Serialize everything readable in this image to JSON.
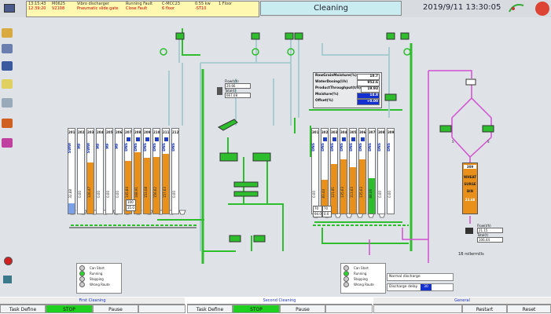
{
  "alarms": [
    {
      "time": "13:15:43",
      "id": "M0625",
      "desc": "Vibro discharger",
      "status": "Running Fault",
      "loc": "C-MCC23",
      "val": "0.55 kw",
      "floor": "1 Floor"
    },
    {
      "time": "12:39:20",
      "id": "V2108",
      "desc": "Pneumatic slide gate",
      "status": "Close Fault",
      "loc": "6 floor",
      "val": "-ST10",
      "floor": ""
    }
  ],
  "header": {
    "title": "Cleaning",
    "datetime": "2019/9/11 13:30:05"
  },
  "flow_left": {
    "title": "Flow(t/h)",
    "value1": "20.66",
    "total_label": "Total(t)",
    "value2": "667.08"
  },
  "flow_right": {
    "title": "Flow(t/h)",
    "value1": "21.15",
    "total_label": "Total(t)",
    "value2": "106.44",
    "caption": "1B rollermills"
  },
  "grain_info": [
    {
      "label": "RawGrainMoisture(%)",
      "value": "10.7",
      "blue": false
    },
    {
      "label": "WaterDosing(l/h)",
      "value": "952.6",
      "blue": false
    },
    {
      "label": "ProductThroughput(t/h)",
      "value": "19.93",
      "blue": false
    },
    {
      "label": "Moisture(%)",
      "value": "14.8",
      "blue": true
    },
    {
      "label": "Offset(%)",
      "value": "+0.00",
      "blue": true
    }
  ],
  "silos_left": [
    {
      "num": "201",
      "cls": "SWW",
      "val": "32.88",
      "fill": 0.12,
      "orange": false,
      "blue": false
    },
    {
      "num": "202",
      "cls": "MF",
      "val": "0.00",
      "fill": 0,
      "orange": false,
      "blue": false
    },
    {
      "num": "203",
      "cls": "SWW",
      "val": "126.47",
      "fill": 0.6,
      "orange": true,
      "blue": false
    },
    {
      "num": "204",
      "cls": "MF",
      "val": "0.00",
      "fill": 0,
      "orange": false,
      "blue": false
    },
    {
      "num": "205",
      "cls": "MF",
      "val": "0.00",
      "fill": 0,
      "orange": false,
      "blue": false
    },
    {
      "num": "206",
      "cls": "MF",
      "val": "0.00",
      "fill": 0,
      "orange": false,
      "blue": false
    },
    {
      "num": "207",
      "cls": "DNS",
      "val": "145.84",
      "fill": 0.62,
      "orange": true,
      "blue": true
    },
    {
      "num": "208",
      "cls": "DNS",
      "val": "168.91",
      "fill": 0.72,
      "orange": true,
      "blue": true
    },
    {
      "num": "209",
      "cls": "DNS",
      "val": "153.08",
      "fill": 0.66,
      "orange": true,
      "blue": true
    },
    {
      "num": "210",
      "cls": "DNS",
      "val": "156.62",
      "fill": 0.67,
      "orange": true,
      "blue": true
    },
    {
      "num": "211",
      "cls": "DNS",
      "val": "157.63",
      "fill": 0.7,
      "orange": true,
      "blue": true
    },
    {
      "num": "212",
      "cls": "DNS",
      "val": "0.00",
      "fill": 0,
      "orange": false,
      "blue": false
    }
  ],
  "silos_right": [
    {
      "num": "301",
      "cls": "DNS",
      "val": "0.00",
      "fill": 0,
      "orange": false,
      "blue": false,
      "green": false
    },
    {
      "num": "302",
      "cls": "DNS",
      "val": "83.44",
      "fill": 0.4,
      "orange": true,
      "blue": true,
      "green": false
    },
    {
      "num": "303",
      "cls": "DNS",
      "val": "121.81",
      "fill": 0.58,
      "orange": true,
      "blue": true,
      "green": false
    },
    {
      "num": "304",
      "cls": "DNS",
      "val": "135.63",
      "fill": 0.64,
      "orange": true,
      "blue": true,
      "green": false
    },
    {
      "num": "305",
      "cls": "DNS",
      "val": "113.63",
      "fill": 0.55,
      "orange": true,
      "blue": true,
      "green": false
    },
    {
      "num": "306",
      "cls": "DNS",
      "val": "135.63",
      "fill": 0.64,
      "orange": true,
      "blue": true,
      "green": false
    },
    {
      "num": "307",
      "cls": "DNS",
      "val": "88.06",
      "fill": 0.42,
      "orange": false,
      "blue": false,
      "green": true
    },
    {
      "num": "308",
      "cls": "DNS",
      "val": "0.00",
      "fill": 0,
      "orange": false,
      "blue": false,
      "green": false
    },
    {
      "num": "309",
      "cls": "DNS",
      "val": "0.00",
      "fill": 0,
      "orange": false,
      "blue": false,
      "green": false
    }
  ],
  "wheat_silo": {
    "num": "309",
    "line1": "WHEAT",
    "line2": "SURGE",
    "line3": "BIN",
    "val": "23.68",
    "fill": 0.95
  },
  "small_labels_left": [
    "100",
    "35.0"
  ],
  "small_labels_right": [
    "70",
    "70",
    "94.0",
    "0.0"
  ],
  "legend": [
    "Can Start",
    "Running",
    "Stopping",
    "Wrong Route"
  ],
  "discharge": {
    "normal": "Normal discharge",
    "delay_label": "Discharge delay",
    "delay_value": "30"
  },
  "bottom": {
    "sections": [
      "First Cleaning",
      "Second Cleaning",
      "General"
    ],
    "buttons": [
      "Task Define",
      "STOP",
      "Pause",
      "Task Define",
      "STOP",
      "Pause",
      "Restart",
      "Reset"
    ]
  },
  "colors": {
    "orange": "#e8901a",
    "green": "#2dbd2d",
    "blue": "#1530d0",
    "pipe": "#a8ccd0",
    "magenta": "#d050d0"
  }
}
